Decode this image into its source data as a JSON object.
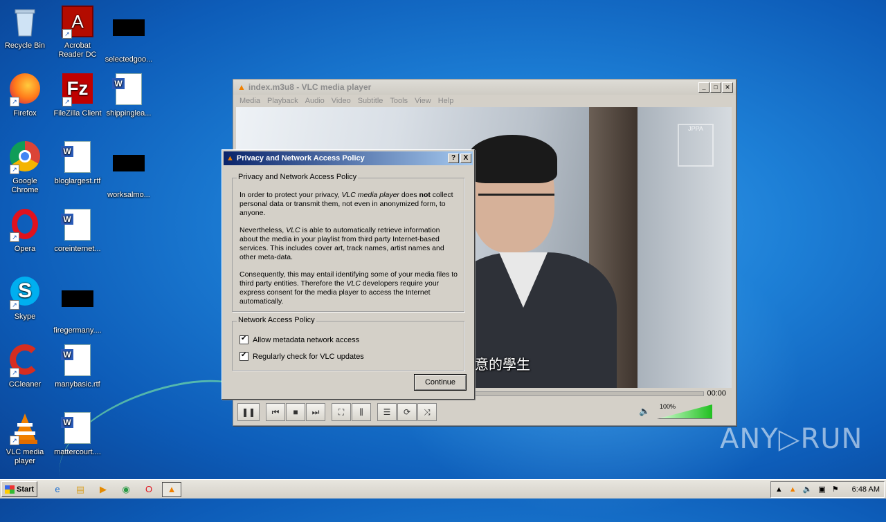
{
  "desktop_icons": [
    {
      "label": "Recycle Bin",
      "icon": "recycle-bin-icon"
    },
    {
      "label": "Acrobat\nReader DC",
      "icon": "acrobat-icon"
    },
    {
      "label": "selectedgoo...",
      "icon": "blacked-out-file-icon"
    },
    {
      "label": "Firefox",
      "icon": "firefox-icon"
    },
    {
      "label": "FileZilla Client",
      "icon": "filezilla-icon"
    },
    {
      "label": "shippinglea...",
      "icon": "word-doc-icon"
    },
    {
      "label": "Google\nChrome",
      "icon": "chrome-icon"
    },
    {
      "label": "bloglargest.rtf",
      "icon": "word-doc-icon"
    },
    {
      "label": "worksalmo...",
      "icon": "blacked-out-file-icon"
    },
    {
      "label": "Opera",
      "icon": "opera-icon"
    },
    {
      "label": "coreinternet...",
      "icon": "word-doc-icon"
    },
    {
      "label": "Skype",
      "icon": "skype-icon"
    },
    {
      "label": "firegermany....",
      "icon": "blacked-out-file-icon"
    },
    {
      "label": "CCleaner",
      "icon": "ccleaner-icon"
    },
    {
      "label": "manybasic.rtf",
      "icon": "word-doc-icon"
    },
    {
      "label": "VLC media\nplayer",
      "icon": "vlc-icon"
    },
    {
      "label": "mattercourt....",
      "icon": "word-doc-icon"
    }
  ],
  "vlc": {
    "title": "index.m3u8 - VLC media player",
    "menu": [
      "Media",
      "Playback",
      "Audio",
      "Video",
      "Subtitle",
      "Tools",
      "View",
      "Help"
    ],
    "subtitle_text": "意的學生",
    "watermark": "JPPA",
    "time": "00:00",
    "volume": "100%"
  },
  "dialog": {
    "title": "Privacy and Network Access Policy",
    "group1_title": "Privacy and Network Access Policy",
    "p1_a": "In order to protect your privacy, ",
    "p1_em": "VLC media player",
    "p1_b": " does ",
    "p1_strong": "not",
    "p1_c": " collect personal data or transmit them, not even in anonymized form, to anyone.",
    "p2_a": "Nevertheless, ",
    "p2_em": "VLC",
    "p2_b": " is able to automatically retrieve information about the media in your playlist from third party Internet-based services. This includes cover art, track names, artist names and other meta-data.",
    "p3_a": "Consequently, this may entail identifying some of your media files to third party entities. Therefore the ",
    "p3_em": "VLC",
    "p3_b": " developers require your express consent for the media player to access the Internet automatically.",
    "group2_title": "Network Access Policy",
    "check1": "Allow metadata network access",
    "check2": "Regularly check for VLC updates",
    "continue": "Continue",
    "help_btn": "?",
    "close_btn": "X"
  },
  "taskbar": {
    "start": "Start",
    "clock": "6:48 AM"
  },
  "watermark": "ANY▷RUN",
  "colors": {
    "dialog_title_start": "#0a246a",
    "dialog_title_end": "#a6caf0",
    "desktop": "#1d7fd6"
  }
}
